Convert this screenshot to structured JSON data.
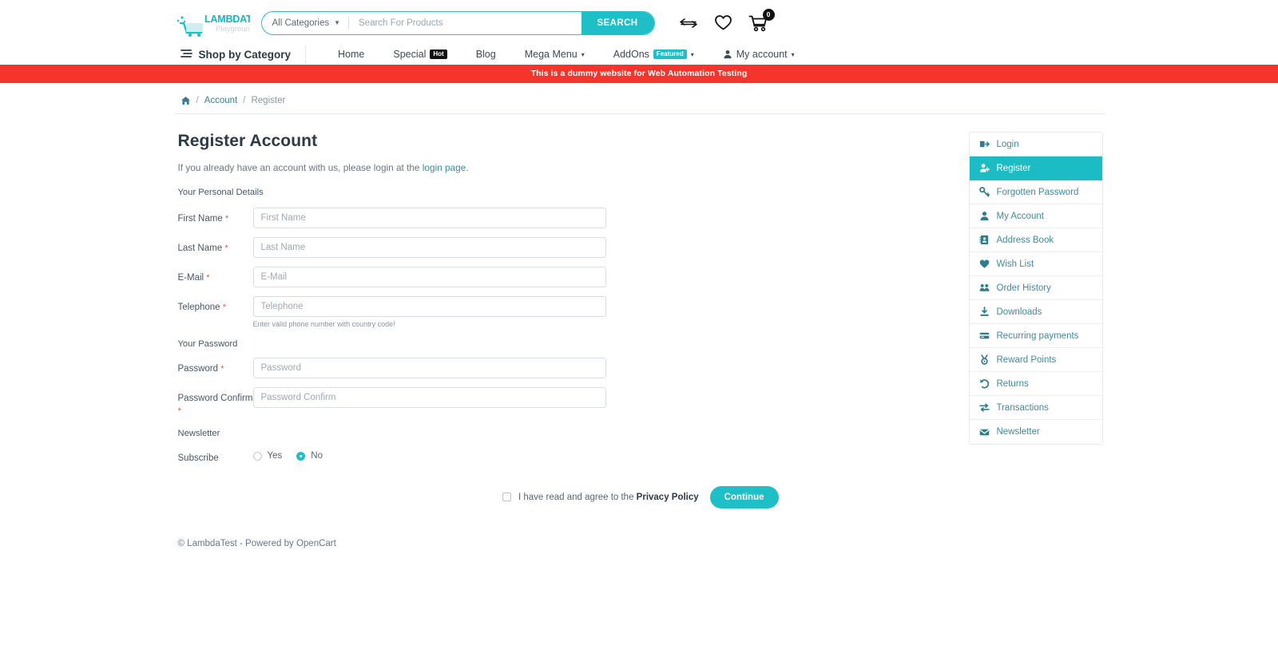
{
  "brand": {
    "name": "LAMBDATEST",
    "sub": "Playground",
    "accent": "#1fbfc8",
    "dark": "#111111",
    "danger": "#f5342b"
  },
  "search": {
    "category_label": "All Categories",
    "placeholder": "Search For Products",
    "value": "",
    "button_label": "SEARCH"
  },
  "top_icons": {
    "compare": "compare-icon",
    "wishlist": "heart-icon",
    "cart": "cart-icon",
    "cart_count": "0"
  },
  "nav": {
    "shop_by_category": "Shop by Category",
    "items": [
      {
        "label": "Home",
        "badge": "",
        "caret": false
      },
      {
        "label": "Special",
        "badge": "Hot",
        "badge_style": "dark",
        "caret": false
      },
      {
        "label": "Blog",
        "badge": "",
        "caret": false
      },
      {
        "label": "Mega Menu",
        "badge": "",
        "caret": true
      },
      {
        "label": "AddOns",
        "badge": "Featured",
        "badge_style": "accent",
        "caret": true
      },
      {
        "label": "My account",
        "badge": "",
        "caret": true
      }
    ]
  },
  "banner": {
    "text": "This is a dummy website for Web Automation Testing"
  },
  "breadcrumb": {
    "home_icon": "home-icon",
    "items": [
      "Account",
      "Register"
    ]
  },
  "page": {
    "title": "Register Account",
    "intro_before": "If you already have an account with us, please login at the ",
    "intro_link": "login page",
    "intro_after": ".",
    "personal_details_legend": "Your Personal Details",
    "password_legend": "Your Password",
    "newsletter_legend": "Newsletter"
  },
  "form": {
    "fields": [
      {
        "label": "First Name",
        "required": true,
        "placeholder": "First Name",
        "value": "",
        "type": "text",
        "help": ""
      },
      {
        "label": "Last Name",
        "required": true,
        "placeholder": "Last Name",
        "value": "",
        "type": "text",
        "help": ""
      },
      {
        "label": "E-Mail",
        "required": true,
        "placeholder": "E-Mail",
        "value": "",
        "type": "text",
        "help": ""
      },
      {
        "label": "Telephone",
        "required": true,
        "placeholder": "Telephone",
        "value": "",
        "type": "text",
        "help": "Enter valid phone number with country code!"
      }
    ],
    "password_fields": [
      {
        "label": "Password",
        "required": true,
        "placeholder": "Password",
        "value": "",
        "type": "password",
        "help": ""
      },
      {
        "label": "Password Confirm",
        "required": true,
        "placeholder": "Password Confirm",
        "value": "",
        "type": "password",
        "help": ""
      }
    ],
    "subscribe": {
      "label": "Subscribe",
      "options": [
        {
          "label": "Yes",
          "selected": false
        },
        {
          "label": "No",
          "selected": true
        }
      ]
    },
    "agree": {
      "checked": false,
      "text_before": "I have read and agree to the ",
      "link": "Privacy Policy"
    },
    "continue_label": "Continue"
  },
  "sidebar": {
    "items": [
      {
        "label": "Login",
        "icon": "login-icon",
        "active": false
      },
      {
        "label": "Register",
        "icon": "user-plus-icon",
        "active": true
      },
      {
        "label": "Forgotten Password",
        "icon": "key-icon",
        "active": false
      },
      {
        "label": "My Account",
        "icon": "user-icon",
        "active": false
      },
      {
        "label": "Address Book",
        "icon": "address-book-icon",
        "active": false
      },
      {
        "label": "Wish List",
        "icon": "heart-filled-icon",
        "active": false
      },
      {
        "label": "Order History",
        "icon": "order-history-icon",
        "active": false
      },
      {
        "label": "Downloads",
        "icon": "download-icon",
        "active": false
      },
      {
        "label": "Recurring payments",
        "icon": "credit-card-icon",
        "active": false
      },
      {
        "label": "Reward Points",
        "icon": "medal-icon",
        "active": false
      },
      {
        "label": "Returns",
        "icon": "undo-icon",
        "active": false
      },
      {
        "label": "Transactions",
        "icon": "exchange-icon",
        "active": false
      },
      {
        "label": "Newsletter",
        "icon": "envelope-icon",
        "active": false
      }
    ]
  },
  "footer": {
    "text": "© LambdaTest - Powered by OpenCart"
  }
}
